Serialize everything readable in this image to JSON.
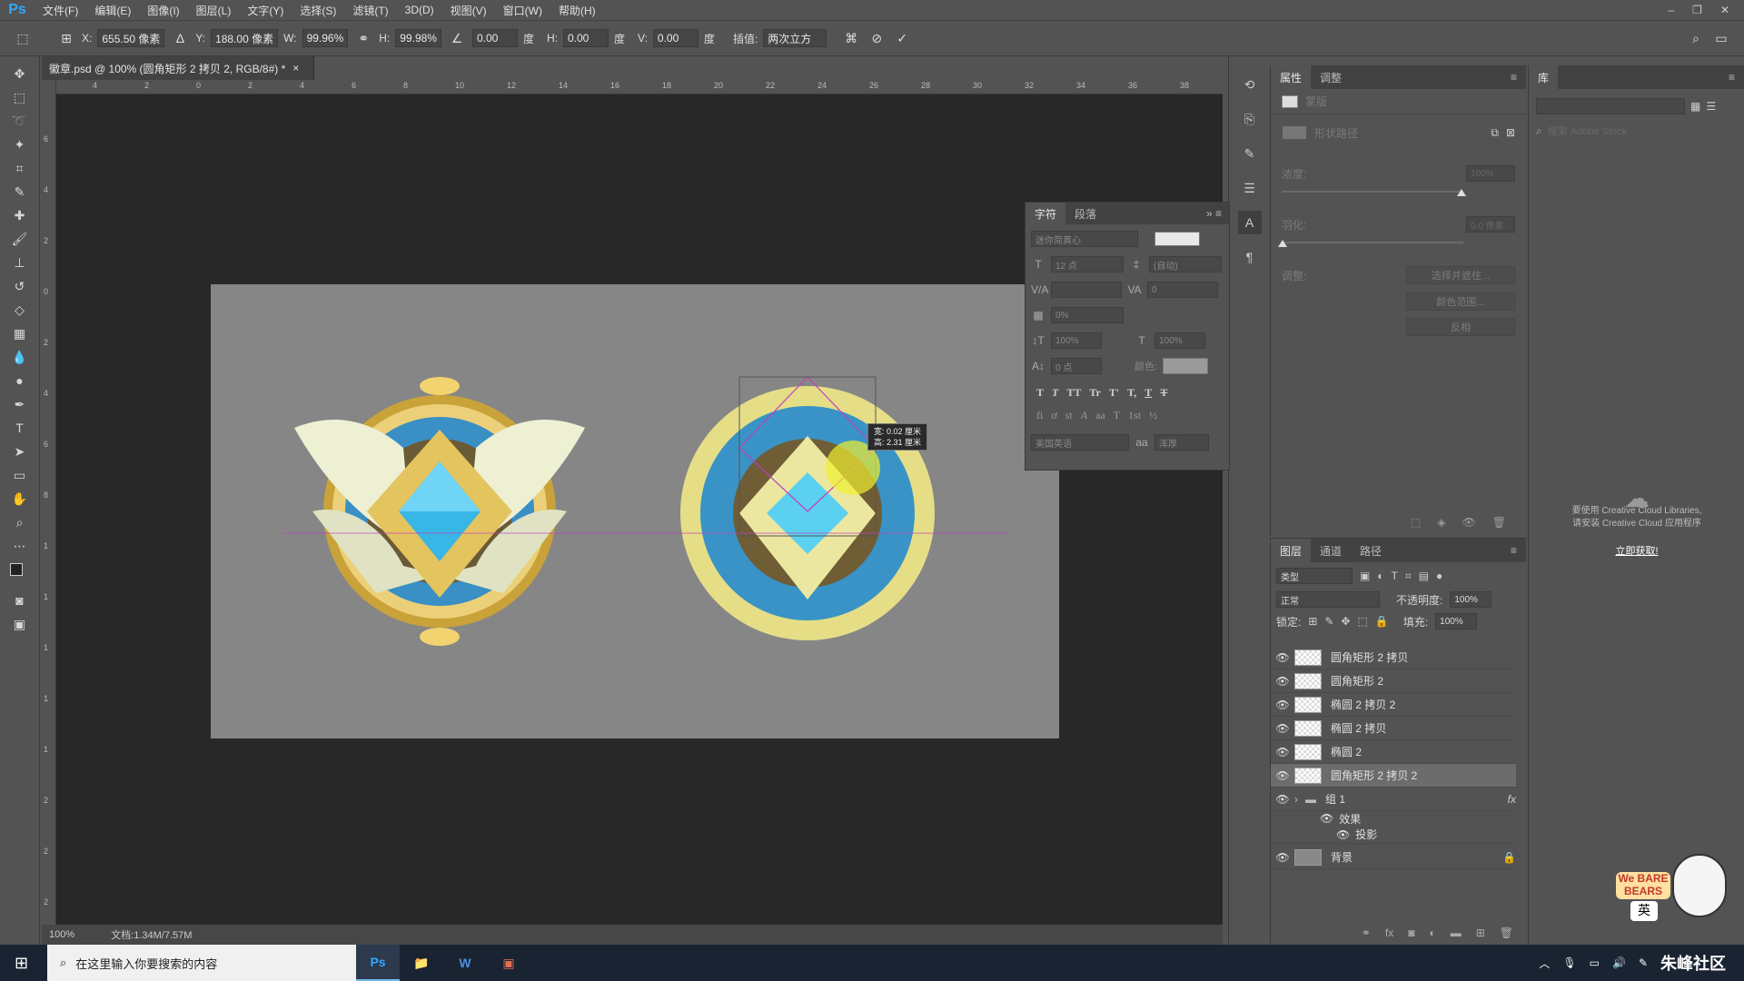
{
  "app": {
    "logo": "Ps"
  },
  "menu": [
    "文件(F)",
    "编辑(E)",
    "图像(I)",
    "图层(L)",
    "文字(Y)",
    "选择(S)",
    "滤镜(T)",
    "3D(D)",
    "视图(V)",
    "窗口(W)",
    "帮助(H)"
  ],
  "window_controls": {
    "minimize": "–",
    "restore": "❐",
    "close": "✕"
  },
  "options": {
    "x_label": "X:",
    "x_value": "655.50 像素",
    "y_label": "Y:",
    "y_value": "188.00 像素",
    "w_label": "W:",
    "w_value": "99.96%",
    "h_label": "H:",
    "h_value": "99.98%",
    "angle_value": "0.00",
    "angle_unit": "度",
    "hskew_label": "H:",
    "hskew_value": "0.00",
    "hskew_unit": "度",
    "vskew_label": "V:",
    "vskew_value": "0.00",
    "vskew_unit": "度",
    "interp_label": "插值:",
    "interp_value": "两次立方"
  },
  "document": {
    "tab_title": "徽章.psd @ 100% (圆角矩形 2 拷贝 2, RGB/8#) *",
    "ruler_h": [
      "4",
      "2",
      "0",
      "2",
      "4",
      "6",
      "8",
      "10",
      "12",
      "14",
      "16",
      "18",
      "20",
      "22",
      "24",
      "26",
      "28",
      "30",
      "32",
      "34",
      "36",
      "38"
    ],
    "ruler_v": [
      "6",
      "4",
      "2",
      "0",
      "2",
      "4",
      "6",
      "8",
      "1",
      "1",
      "1",
      "1",
      "1",
      "2",
      "2",
      "2"
    ],
    "zoom": "100%",
    "doc_info": "文档:1.34M/7.57M",
    "tooltip_w": "宽: 0.02 厘米",
    "tooltip_h": "高: 2.31 厘米"
  },
  "character_panel": {
    "tabs": [
      "字符",
      "段落"
    ],
    "font_family": "迷你简黄心",
    "font_size": "12 点",
    "leading": "(自动)",
    "kerning": "",
    "tracking": "0",
    "scale_pct": "0%",
    "vscale": "100%",
    "hscale": "100%",
    "baseline": "0 点",
    "color_label": "颜色:",
    "lang": "美国英语",
    "aa": "浑厚",
    "aa_icon": "aa",
    "styles1": [
      "T",
      "T",
      "TT",
      "Tr",
      "T'",
      "T,",
      "T",
      "T"
    ],
    "styles2": [
      "fi",
      "ơ",
      "st",
      "A",
      "aa",
      "T",
      "1st",
      "½"
    ]
  },
  "properties_panel": {
    "tabs": [
      "属性",
      "调整"
    ],
    "mask_label": "蒙版",
    "shape_path_label": "形状路径",
    "density_label": "浓度:",
    "density_value": "100%",
    "feather_label": "羽化:",
    "feather_value": "0.0 像素",
    "adjust_label": "调整:",
    "btn_select_mask": "选择并遮住...",
    "btn_color_range": "颜色范围...",
    "btn_invert": "反相"
  },
  "library_panel": {
    "tab": "库",
    "search_placeholder": "搜索 Adobe Stock",
    "cc_msg1": "要使用 Creative Cloud Libraries,",
    "cc_msg2": "请安装 Creative Cloud 应用程序",
    "cc_link": "立即获取!"
  },
  "layers_panel": {
    "tabs": [
      "图层",
      "通道",
      "路径"
    ],
    "kind_filter": "类型",
    "blend_mode": "正常",
    "opacity_label": "不透明度:",
    "opacity_value": "100%",
    "lock_label": "锁定:",
    "fill_label": "填充:",
    "fill_value": "100%",
    "layers": [
      {
        "name": "圆角矩形 2 拷贝",
        "selected": false
      },
      {
        "name": "圆角矩形 2",
        "selected": false
      },
      {
        "name": "椭圆 2 拷贝 2",
        "selected": false
      },
      {
        "name": "椭圆 2 拷贝",
        "selected": false
      },
      {
        "name": "椭圆 2",
        "selected": false
      },
      {
        "name": "圆角矩形 2 拷贝 2",
        "selected": true
      }
    ],
    "group_name": "组 1",
    "group_fx": "fx",
    "effects_label": "效果",
    "drop_shadow_label": "投影",
    "background_name": "背景"
  },
  "taskbar": {
    "search_placeholder": "在这里输入你要搜索的内容",
    "apps": [
      "Ps",
      "📁",
      "W",
      "▣"
    ],
    "tray_lang": "英",
    "watermark": "朱峰社区"
  },
  "colors": {
    "badge_gold": "#e8c66b",
    "badge_blue": "#3a9ed6",
    "badge_cyan": "#5bd0f0",
    "badge_cream": "#eef0d0",
    "path_magenta": "#c040c0"
  }
}
